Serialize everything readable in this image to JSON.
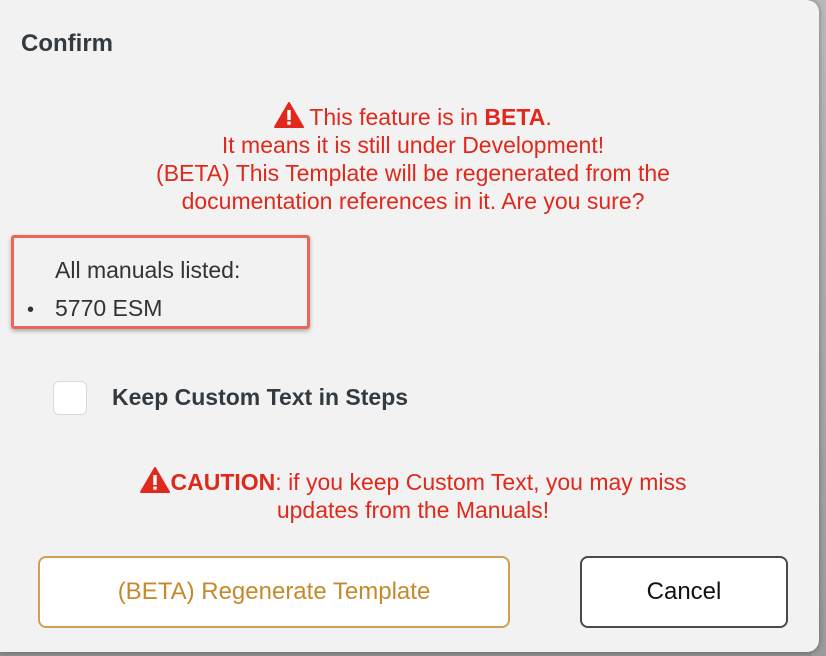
{
  "dialog": {
    "title": "Confirm",
    "beta_notice": {
      "prefix": "This feature is in ",
      "emphasis": "BETA",
      "suffix": ".",
      "line2": "It means it is still under Development!",
      "line3": "(BETA) This Template will be regenerated from the",
      "line4": "documentation references in it. Are you sure?"
    },
    "manuals": {
      "heading": "All manuals listed:",
      "items": [
        "5770 ESM"
      ]
    },
    "keep_custom_text": {
      "label": "Keep Custom Text in Steps",
      "checked": false
    },
    "caution": {
      "emphasis": "CAUTION",
      "text": ": if you keep Custom Text, you may miss",
      "line2": "updates from the Manuals!"
    },
    "buttons": {
      "regenerate": "(BETA) Regenerate Template",
      "cancel": "Cancel"
    }
  },
  "colors": {
    "warning": "#e0291c",
    "highlight_border": "#e8675a",
    "regenerate_accent": "#c68a2c"
  },
  "icons": {
    "warning": "warning-triangle-icon"
  }
}
